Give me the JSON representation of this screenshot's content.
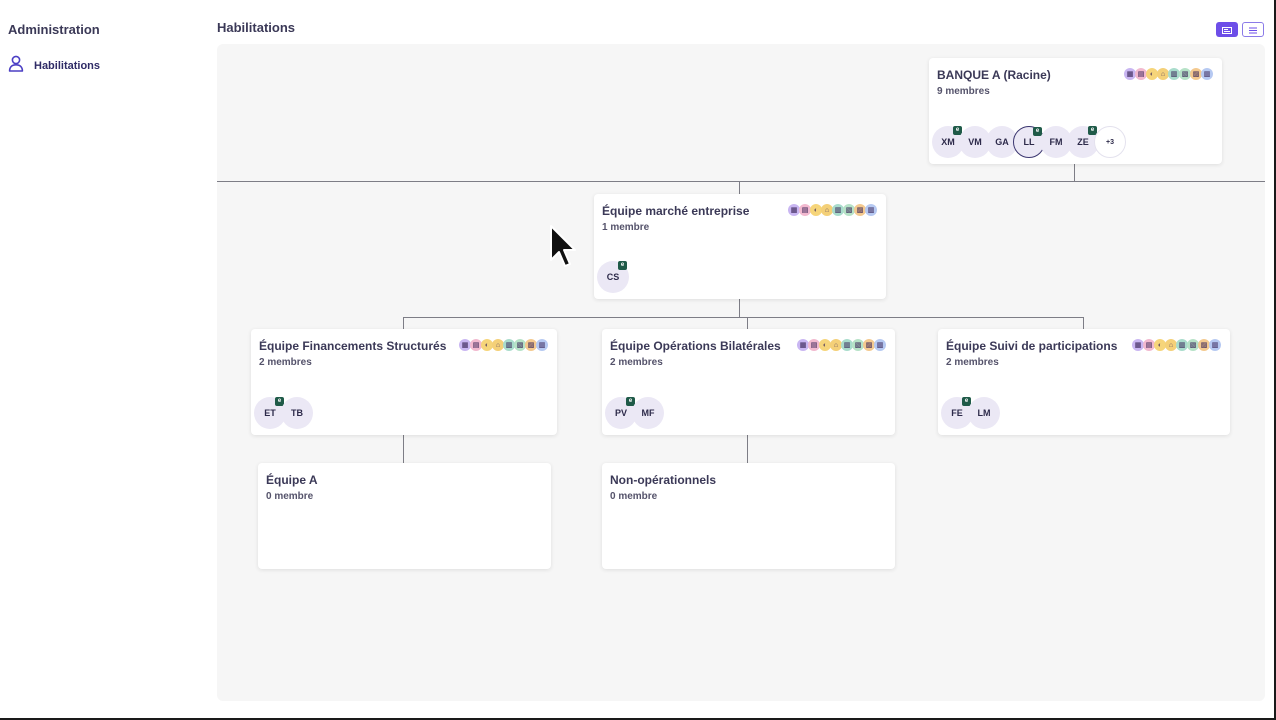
{
  "sidebar": {
    "title": "Administration",
    "items": [
      {
        "label": "Habilitations",
        "icon": "user-icon"
      }
    ]
  },
  "header": {
    "title": "Habilitations",
    "view_toggles": [
      {
        "icon": "card-view-icon",
        "active": true
      },
      {
        "icon": "list-view-icon",
        "active": false
      }
    ]
  },
  "colors": {
    "accent": "#6d4ee8",
    "badge": "#1f5a48",
    "avatar_bg": "#ebe8f5",
    "permission_icons": [
      "#c9b6f2",
      "#f2b9cf",
      "#f6d57a",
      "#f4d078",
      "#a9dccc",
      "#b6e2c7",
      "#f4c98f",
      "#b6c9f2"
    ]
  },
  "org_tree": {
    "root": {
      "name": "BANQUE A (Racine)",
      "count": "9 membres",
      "members": [
        {
          "initials": "XM",
          "badge": true
        },
        {
          "initials": "VM",
          "badge": false
        },
        {
          "initials": "GA",
          "badge": false
        },
        {
          "initials": "LL",
          "badge": true,
          "outlined": true
        },
        {
          "initials": "FM",
          "badge": false
        },
        {
          "initials": "ZE",
          "badge": true
        }
      ],
      "more": "+3"
    },
    "level1": {
      "name": "Équipe marché entreprise",
      "count": "1 membre",
      "members": [
        {
          "initials": "CS",
          "badge": true
        }
      ]
    },
    "level2": [
      {
        "name": "Équipe Financements Structurés",
        "count": "2 membres",
        "members": [
          {
            "initials": "ET",
            "badge": true
          },
          {
            "initials": "TB",
            "badge": false
          }
        ]
      },
      {
        "name": "Équipe Opérations Bilatérales",
        "count": "2 membres",
        "members": [
          {
            "initials": "PV",
            "badge": true
          },
          {
            "initials": "MF",
            "badge": false
          }
        ]
      },
      {
        "name": "Équipe Suivi de participations",
        "count": "2 membres",
        "members": [
          {
            "initials": "FE",
            "badge": true
          },
          {
            "initials": "LM",
            "badge": false
          }
        ]
      }
    ],
    "level3": [
      {
        "name": "Équipe A",
        "count": "0 membre"
      },
      {
        "name": "Non-opérationnels",
        "count": "0 membre"
      }
    ]
  },
  "mouse_cursor": {
    "icon": "mouse-pointer-icon"
  }
}
